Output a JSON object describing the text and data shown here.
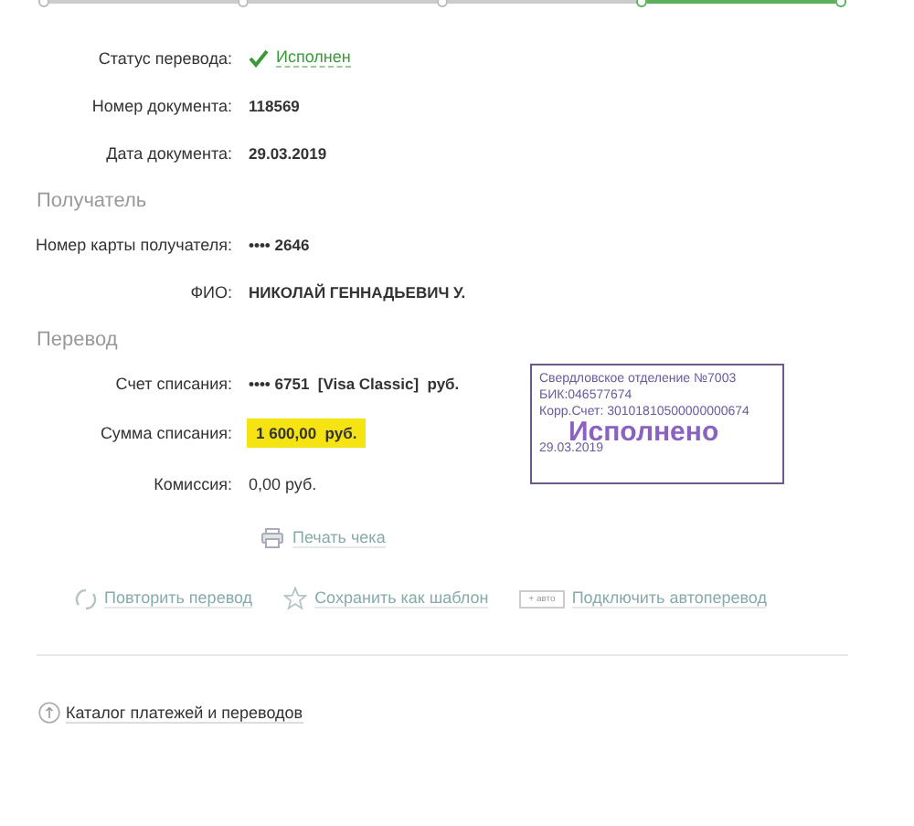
{
  "stepper": {
    "segments": [
      {
        "done": false
      },
      {
        "done": false
      },
      {
        "done": false
      },
      {
        "done": true
      }
    ]
  },
  "status": {
    "label": "Статус перевода:",
    "value": "Исполнен"
  },
  "document_rows": [
    {
      "label": "Номер документа:",
      "value": "118569"
    },
    {
      "label": "Дата документа:",
      "value": "29.03.2019"
    }
  ],
  "recipient": {
    "title": "Получатель",
    "rows": [
      {
        "label": "Номер карты получателя:",
        "value": "•••• 2646",
        "highlight": false,
        "bold": true
      },
      {
        "label": "ФИО:",
        "value": "НИКОЛАЙ ГЕННАДЬЕВИЧ У.",
        "highlight": false,
        "bold": true
      }
    ]
  },
  "transfer": {
    "title": "Перевод",
    "rows": [
      {
        "label": "Счет списания:",
        "value": "•••• 6751  [Visa Classic]  руб.",
        "highlight": false,
        "bold": true
      },
      {
        "label": "Сумма списания:",
        "value": "1 600,00  руб.",
        "highlight": true,
        "bold": true
      },
      {
        "label": "Комиссия:",
        "value": "0,00 руб.",
        "highlight": false,
        "bold": false
      }
    ]
  },
  "stamp": {
    "lines": [
      "Свердловское отделение №7003",
      "БИК:046577674",
      "Корр.Счет: 30101810500000000674"
    ],
    "mark": "Исполнено",
    "date": "29.03.2019"
  },
  "print_link": "Печать чека",
  "actions": [
    {
      "kind": "repeat",
      "label": "Повторить перевод"
    },
    {
      "kind": "template",
      "label": "Сохранить как шаблон"
    },
    {
      "kind": "auto",
      "badge": "+ авто",
      "label": "Подключить автоперевод"
    }
  ],
  "catalog_link": "Каталог платежей и переводов"
}
